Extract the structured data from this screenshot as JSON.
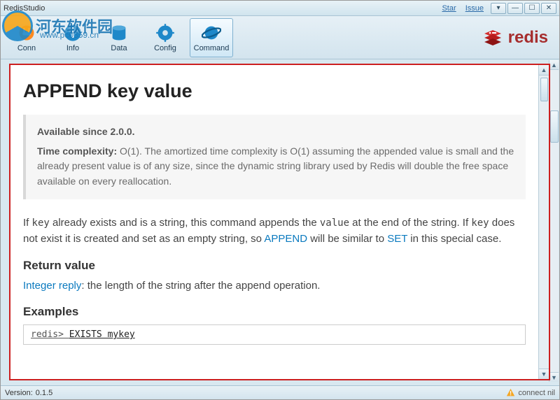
{
  "window": {
    "title": "RedisStudio",
    "links": {
      "star": "Star",
      "issue": "Issue"
    }
  },
  "toolbar": {
    "items": [
      {
        "label": "Conn"
      },
      {
        "label": "Info"
      },
      {
        "label": "Data"
      },
      {
        "label": "Config"
      },
      {
        "label": "Command"
      }
    ],
    "logo_text": "redis"
  },
  "watermark": {
    "text": "河东软件园",
    "url": "www.pc0359.cn"
  },
  "doc": {
    "title": "APPEND key value",
    "available": "Available since 2.0.0.",
    "tc_label": "Time complexity:",
    "tc_text": " O(1). The amortized time complexity is O(1) assuming the appended value is small and the already present value is of any size, since the dynamic string library used by Redis will double the free space available on every reallocation.",
    "body_pre": "If ",
    "body_key1": "key",
    "body_mid1": " already exists and is a string, this command appends the ",
    "body_val": "value",
    "body_mid2": " at the end of the string. If ",
    "body_key2": "key",
    "body_mid3": " does not exist it is created and set as an empty string, so ",
    "link_append": "APPEND",
    "body_mid4": " will be similar to ",
    "link_set": "SET",
    "body_end": " in this special case.",
    "ret_heading": "Return value",
    "ret_link": "Integer reply",
    "ret_text": ": the length of the string after the append operation.",
    "ex_heading": "Examples",
    "ex_prompt": "redis> ",
    "ex_cmd": "EXISTS mykey"
  },
  "status": {
    "version_label": "Version:",
    "version": "0.1.5",
    "connect": "connect nil"
  }
}
